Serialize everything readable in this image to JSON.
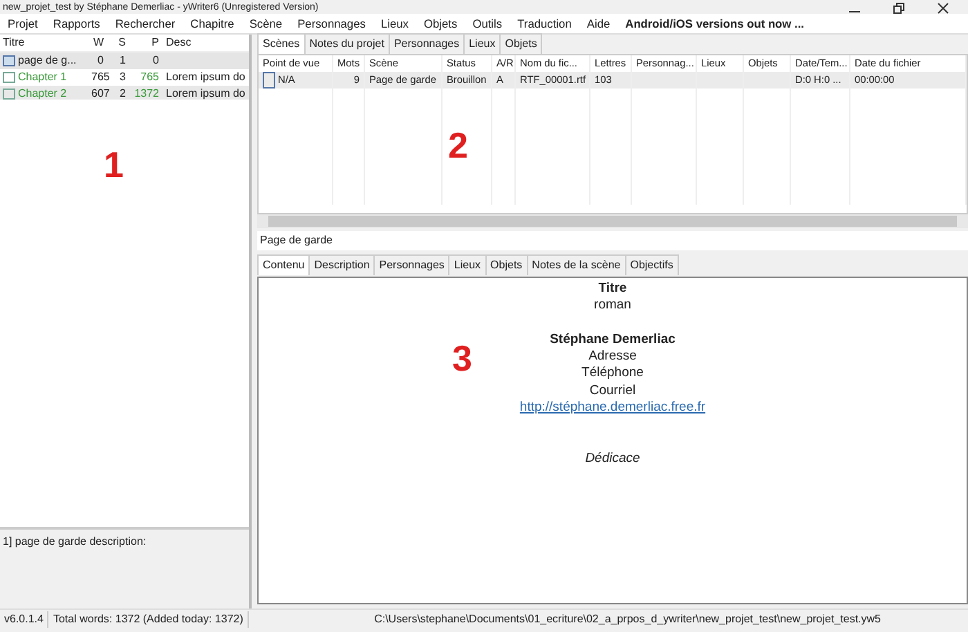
{
  "window": {
    "title": "new_projet_test by Stéphane Demerliac - yWriter6 (Unregistered Version)"
  },
  "menu": [
    {
      "label": "Projet",
      "bold": false
    },
    {
      "label": "Rapports",
      "bold": false
    },
    {
      "label": "Rechercher",
      "bold": false
    },
    {
      "label": "Chapitre",
      "bold": false
    },
    {
      "label": "Scène",
      "bold": false
    },
    {
      "label": "Personnages",
      "bold": false
    },
    {
      "label": "Lieux",
      "bold": false
    },
    {
      "label": "Objets",
      "bold": false
    },
    {
      "label": "Outils",
      "bold": false
    },
    {
      "label": "Traduction",
      "bold": false
    },
    {
      "label": "Aide",
      "bold": false
    },
    {
      "label": "Android/iOS versions out now ...",
      "bold": true
    }
  ],
  "chapters": {
    "columns": [
      "Titre",
      "W",
      "S",
      "P",
      "Desc"
    ],
    "rows": [
      {
        "kind": "info",
        "selected": true,
        "cells": [
          "page de g...",
          "0",
          "1",
          "0",
          ""
        ]
      },
      {
        "kind": "chapter",
        "selected": false,
        "cells": [
          "Chapter 1",
          "765",
          "3",
          "765",
          "Lorem ipsum do"
        ]
      },
      {
        "kind": "chapter",
        "selected": false,
        "cells": [
          "Chapter 2",
          "607",
          "2",
          "1372",
          "Lorem ipsum do"
        ]
      }
    ]
  },
  "chapter_description": "1] page de garde description:",
  "scene_tabs": [
    {
      "label": "Scènes",
      "selected": true
    },
    {
      "label": "Notes du projet",
      "selected": false
    },
    {
      "label": "Personnages",
      "selected": false
    },
    {
      "label": "Lieux",
      "selected": false
    },
    {
      "label": "Objets",
      "selected": false
    }
  ],
  "scenes": {
    "columns": [
      "Point de vue",
      "Mots",
      "Scène",
      "Status",
      "A/R",
      "Nom du fic...",
      "Lettres",
      "Personnag...",
      "Lieux",
      "Objets",
      "Date/Tem...",
      "Date du fichier"
    ],
    "rows": [
      {
        "selected": true,
        "cells": [
          "N/A",
          "9",
          "Page de garde",
          "Brouillon",
          "A",
          "RTF_00001.rtf",
          "103",
          "",
          "",
          "",
          "D:0 H:0 ...",
          "00:00:00"
        ]
      }
    ]
  },
  "scene_title": "Page de garde",
  "editor_tabs": [
    {
      "label": "Contenu",
      "selected": true
    },
    {
      "label": "Description",
      "selected": false
    },
    {
      "label": "Personnages",
      "selected": false
    },
    {
      "label": "Lieux",
      "selected": false
    },
    {
      "label": "Objets",
      "selected": false
    },
    {
      "label": "Notes de la scène",
      "selected": false
    },
    {
      "label": "Objectifs",
      "selected": false
    }
  ],
  "editor_lines": [
    {
      "kind": "bold",
      "text": "Titre"
    },
    {
      "kind": "plain",
      "text": "roman"
    },
    {
      "kind": "blank"
    },
    {
      "kind": "bold",
      "text": "Stéphane Demerliac"
    },
    {
      "kind": "plain",
      "text": "Adresse"
    },
    {
      "kind": "plain",
      "text": "Téléphone"
    },
    {
      "kind": "plain",
      "text": "Courriel"
    },
    {
      "kind": "link",
      "text": "http://stéphane.demerliac.free.fr"
    },
    {
      "kind": "blank"
    },
    {
      "kind": "blank"
    },
    {
      "kind": "italic",
      "text": "Dédicace"
    }
  ],
  "annotations": [
    "1",
    "2",
    "3"
  ],
  "status_bar": {
    "version": "v6.0.1.4",
    "words": "Total words: 1372 (Added today: 1372)",
    "path": "C:\\Users\\stephane\\Documents\\01_ecriture\\02_a_prpos_d_ywriter\\new_projet_test\\new_projet_test.yw5"
  }
}
